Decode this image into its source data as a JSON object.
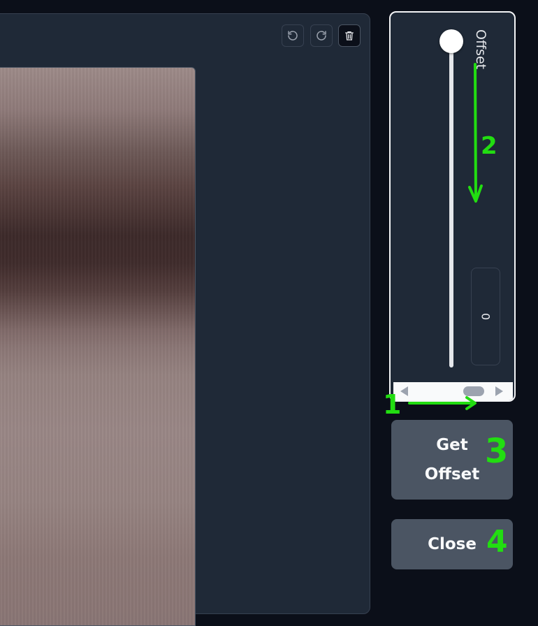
{
  "toolbar": {
    "undo_icon": "undo-icon",
    "redo_icon": "redo-icon",
    "trash_icon": "trash-icon"
  },
  "slider": {
    "label": "Offset",
    "value": "0"
  },
  "buttons": {
    "get_offset": "Get Offset",
    "close": "Close"
  },
  "annotations": {
    "step1": "1",
    "step2": "2",
    "step3": "3",
    "step4": "4",
    "color": "#22dd11"
  }
}
